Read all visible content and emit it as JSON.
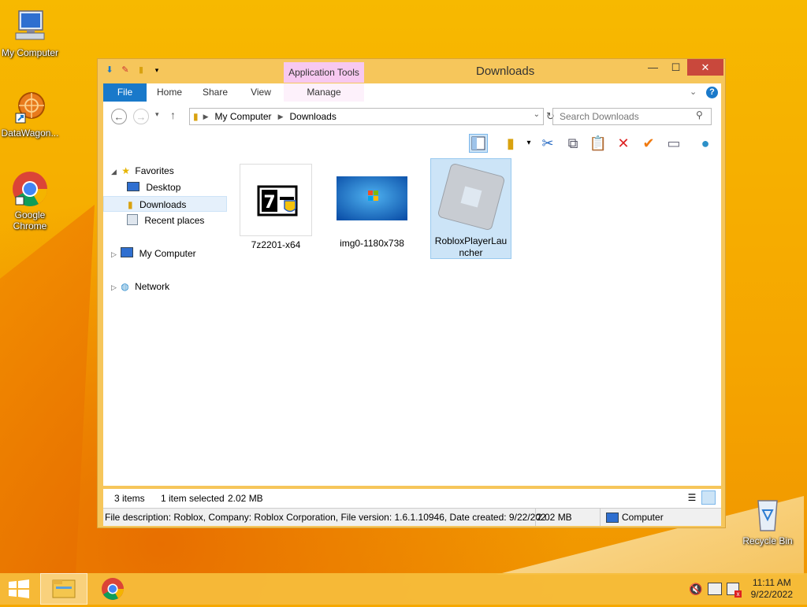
{
  "desktop": {
    "icons": [
      {
        "label": "My Computer"
      },
      {
        "label": "DataWagon..."
      },
      {
        "label": "Google Chrome"
      },
      {
        "label": "Recycle Bin"
      }
    ]
  },
  "window": {
    "title": "Downloads",
    "context_tab_group": "Application Tools",
    "tabs": [
      {
        "label": "File"
      },
      {
        "label": "Home"
      },
      {
        "label": "Share"
      },
      {
        "label": "View"
      },
      {
        "label": "Manage"
      }
    ],
    "address": {
      "crumbs": [
        "My Computer",
        "Downloads"
      ]
    },
    "search": {
      "placeholder": "Search Downloads"
    },
    "nav": {
      "favorites_label": "Favorites",
      "favorites": [
        "Desktop",
        "Downloads",
        "Recent places"
      ],
      "my_computer": "My Computer",
      "network": "Network"
    },
    "files": [
      {
        "name": "7z2201-x64"
      },
      {
        "name": "img0-1180x738"
      },
      {
        "name_line1": "RobloxPlayerLau",
        "name_line2": "ncher"
      }
    ],
    "status": {
      "item_count": "3 items",
      "selected": "1 item selected",
      "size": "2.02 MB"
    },
    "details_bar": {
      "description": "File description: Roblox, Company: Roblox Corporation, File version: 1.6.1.10946, Date created: 9/22/202",
      "size": "2.02 MB",
      "location": "Computer"
    }
  },
  "taskbar": {
    "time": "11:11 AM",
    "date": "9/22/2022"
  },
  "colors": {
    "accent": "#1979ca",
    "desktop": "#f6a800",
    "close": "#c9483c",
    "app_tools": "#f7c8f0",
    "selection": "#cce4f7"
  }
}
